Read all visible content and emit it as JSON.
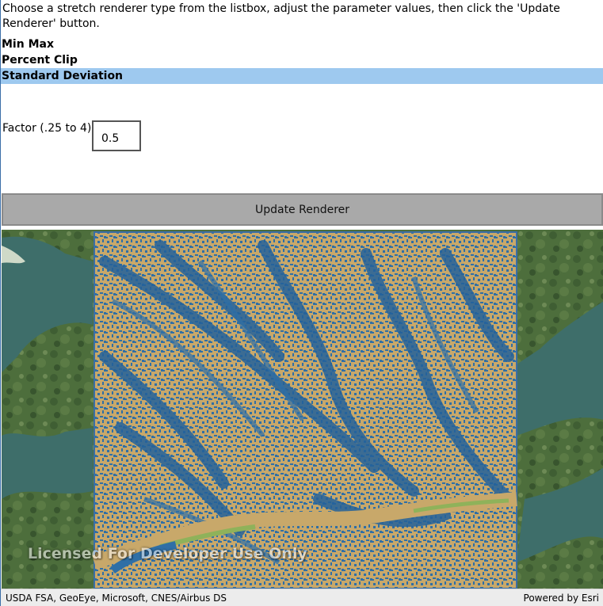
{
  "instructions": "Choose a stretch renderer type from the listbox, adjust the parameter values, then click the 'Update Renderer' button.",
  "renderer_types": [
    {
      "label": "Min Max",
      "selected": false
    },
    {
      "label": "Percent Clip",
      "selected": false
    },
    {
      "label": "Standard Deviation",
      "selected": true
    }
  ],
  "factor": {
    "label": "Factor (.25 to 4):",
    "value": "0.5"
  },
  "update_button": {
    "label": "Update Renderer"
  },
  "map": {
    "watermark": "Licensed For Developer Use Only",
    "attribution": "USDA FSA, GeoEye, Microsoft, CNES/Airbus DS",
    "powered_by": "Powered by Esri",
    "colors": {
      "raster_tan": "#c8a86a",
      "raster_blue": "#2f6fa6",
      "raster_green": "#8fb25a",
      "water": "#3e6e6a",
      "land": "#4f6f3e"
    }
  }
}
